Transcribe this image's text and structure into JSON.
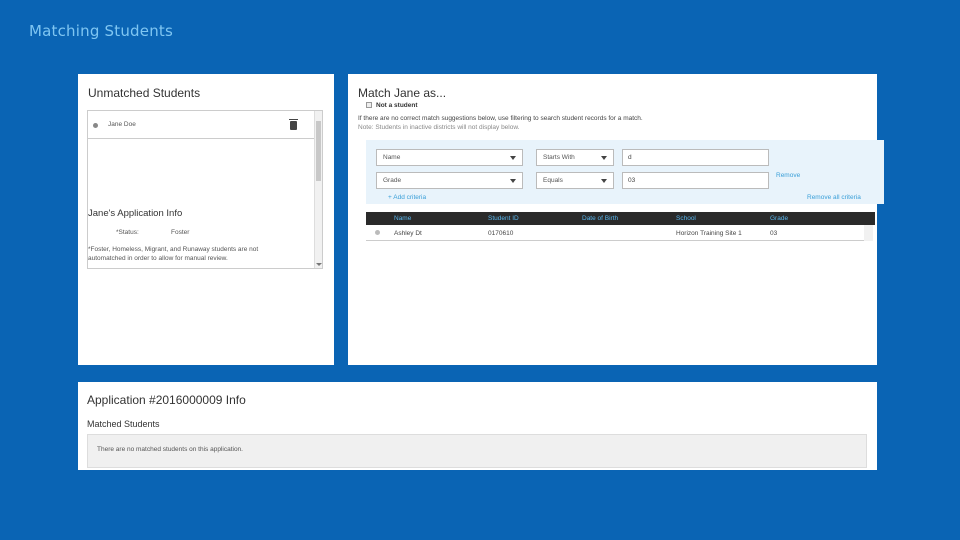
{
  "slide": {
    "title": "Matching Students"
  },
  "unmatched": {
    "title": "Unmatched Students",
    "students": [
      {
        "name": "Jane Doe"
      }
    ]
  },
  "app_info": {
    "title": "Jane's Application Info",
    "status_label": "*Status:",
    "status_value": "Foster",
    "note": "*Foster, Homeless, Migrant, and Runaway students are not automatched in order to allow for manual review."
  },
  "match": {
    "title": "Match Jane as...",
    "not_student_label": "Not a student",
    "hint1": "If there are no correct match suggestions below, use filtering to search student records for a match.",
    "hint2": "Note: Students in inactive districts will not display below.",
    "filters": [
      {
        "field": "Name",
        "operator": "Starts With",
        "value": "d"
      },
      {
        "field": "Grade",
        "operator": "Equals",
        "value": "03"
      }
    ],
    "remove_label": "Remove",
    "add_criteria_label": "+ Add criteria",
    "remove_all_label": "Remove all criteria",
    "table": {
      "headers": [
        "Name",
        "Student ID",
        "Date of Birth",
        "School",
        "Grade"
      ],
      "rows": [
        [
          "Ashley Dt",
          "0170610",
          "",
          "Horizon Training Site 1",
          "03"
        ]
      ]
    }
  },
  "application": {
    "title": "Application #2016000009 Info",
    "matched_title": "Matched Students",
    "empty_message": "There are no matched students on this application."
  }
}
